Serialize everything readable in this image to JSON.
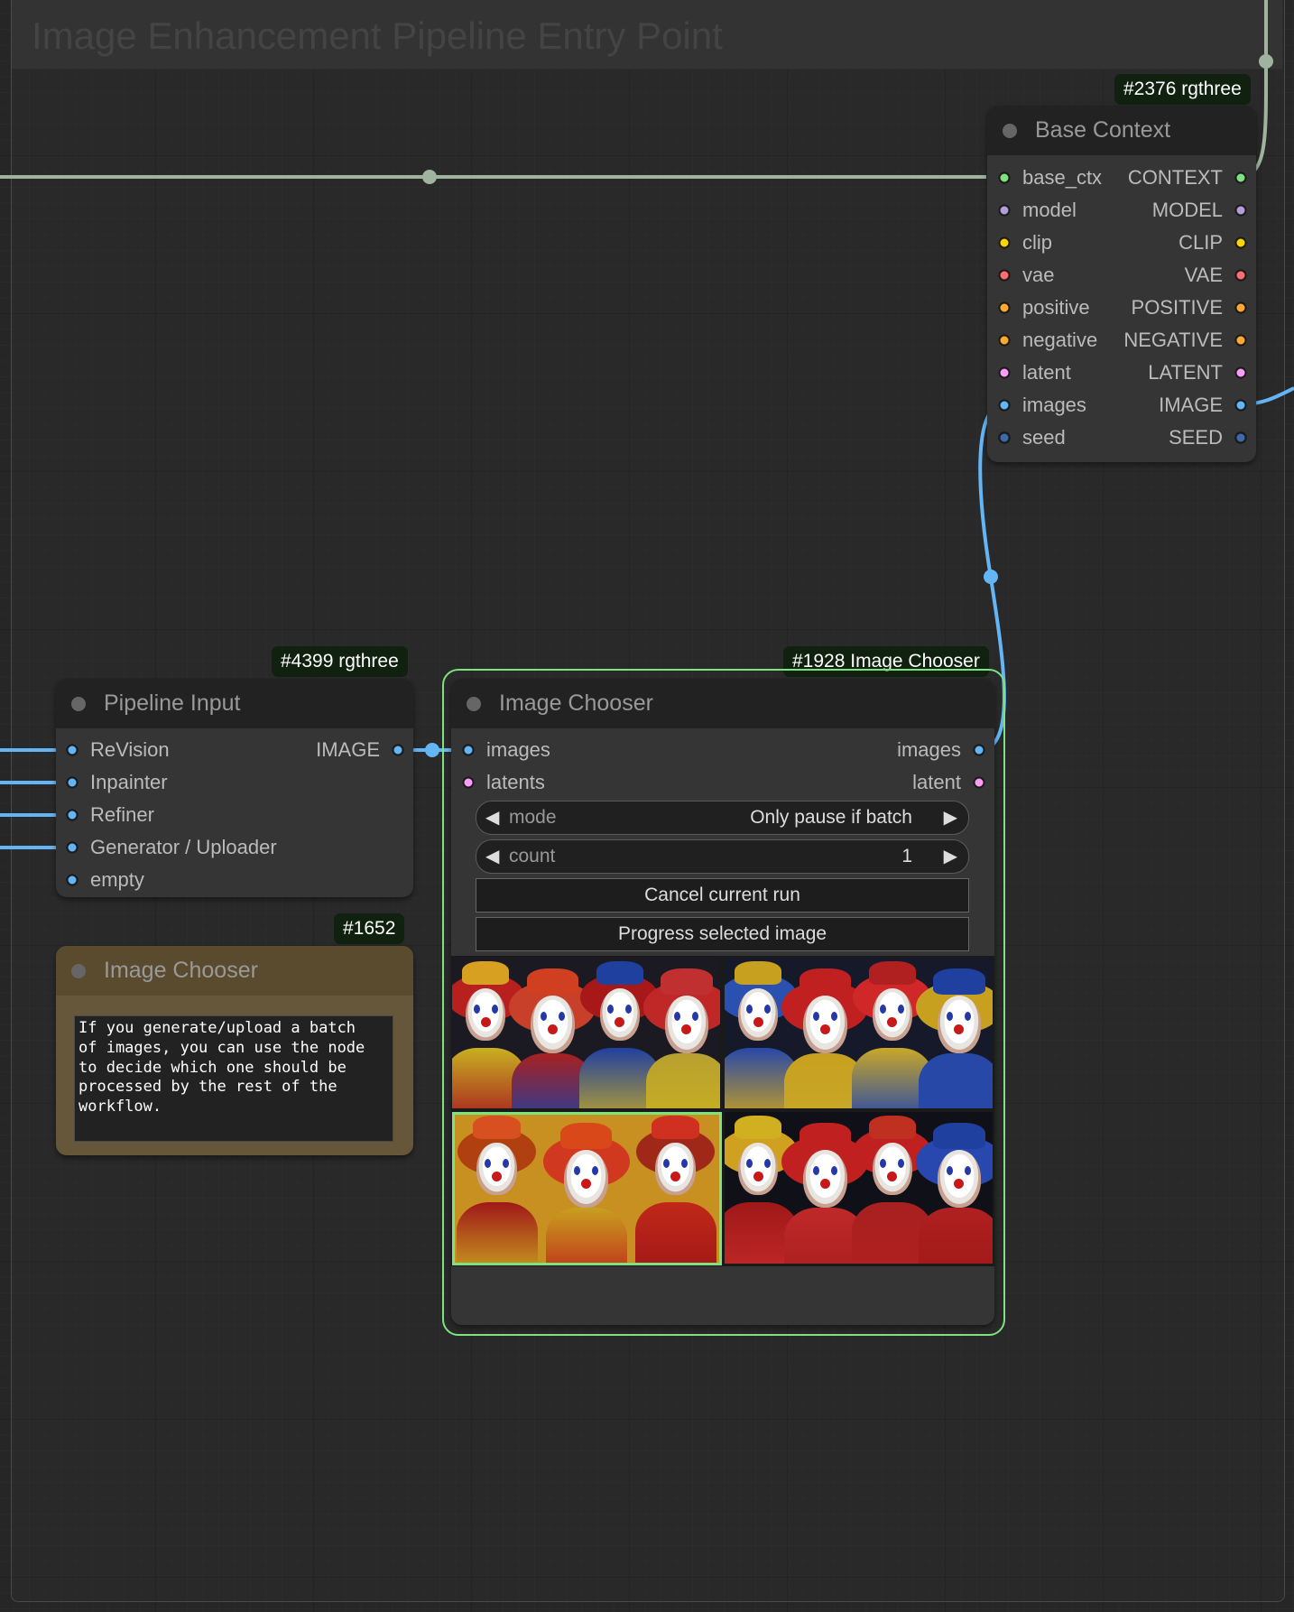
{
  "group": {
    "title": "Image Enhancement Pipeline Entry Point"
  },
  "base_context": {
    "badge": "#2376 rgthree",
    "title": "Base Context",
    "inputs": [
      {
        "label": "base_ctx",
        "color": "#7ee27e"
      },
      {
        "label": "model",
        "color": "#b39ddb"
      },
      {
        "label": "clip",
        "color": "#ffd500"
      },
      {
        "label": "vae",
        "color": "#ff6e6e"
      },
      {
        "label": "positive",
        "color": "#ffa931"
      },
      {
        "label": "negative",
        "color": "#ffa931"
      },
      {
        "label": "latent",
        "color": "#ff9cf9"
      },
      {
        "label": "images",
        "color": "#64b5f6"
      },
      {
        "label": "seed",
        "color": "#3d6baa"
      }
    ],
    "outputs": [
      {
        "label": "CONTEXT",
        "color": "#7ee27e"
      },
      {
        "label": "MODEL",
        "color": "#b39ddb"
      },
      {
        "label": "CLIP",
        "color": "#ffd500"
      },
      {
        "label": "VAE",
        "color": "#ff6e6e"
      },
      {
        "label": "POSITIVE",
        "color": "#ffa931"
      },
      {
        "label": "NEGATIVE",
        "color": "#ffa931"
      },
      {
        "label": "LATENT",
        "color": "#ff9cf9"
      },
      {
        "label": "IMAGE",
        "color": "#64b5f6"
      },
      {
        "label": "SEED",
        "color": "#3d6baa"
      }
    ]
  },
  "pipeline_input": {
    "badge": "#4399 rgthree",
    "title": "Pipeline Input",
    "inputs": [
      "ReVision",
      "Inpainter",
      "Refiner",
      "Generator / Uploader",
      "empty"
    ],
    "input_color": "#64b5f6",
    "output": "IMAGE"
  },
  "note": {
    "badge": "#1652",
    "title": "Image Chooser",
    "text": "If you generate/upload a batch\nof images, you can use the node\nto decide which one should be\nprocessed by the rest of the\nworkflow."
  },
  "image_chooser": {
    "badge": "#1928 Image Chooser",
    "title": "Image Chooser",
    "inputs": [
      {
        "label": "images",
        "color": "#64b5f6"
      },
      {
        "label": "latents",
        "color": "#ff9cf9"
      }
    ],
    "outputs": [
      {
        "label": "images",
        "color": "#64b5f6"
      },
      {
        "label": "latent",
        "color": "#ff9cf9"
      }
    ],
    "mode_label": "mode",
    "mode_value": "Only pause if batch",
    "count_label": "count",
    "count_value": "1",
    "cancel_label": "Cancel current run",
    "progress_label": "Progress selected image",
    "selected_index": 2,
    "selected_color": "#7ee27e"
  },
  "colors": {
    "context_link": "#9fb39f",
    "image_link": "#64b5f6",
    "selection": "#7ee27e"
  }
}
